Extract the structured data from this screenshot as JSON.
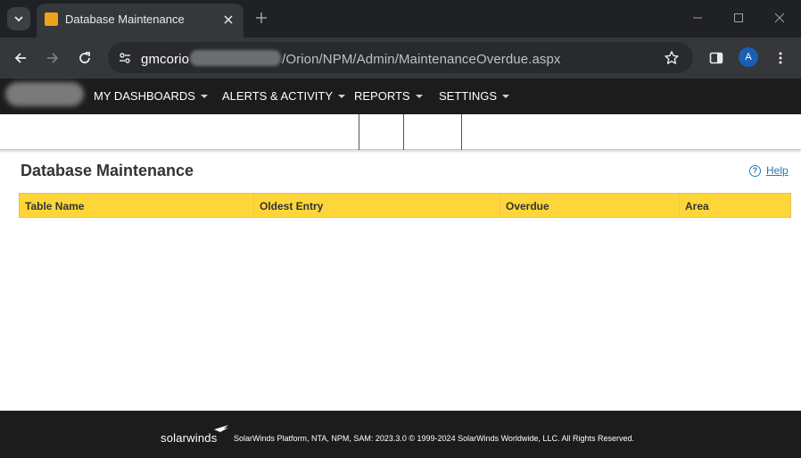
{
  "browser": {
    "tab_title": "Database Maintenance",
    "url_host": "gmcorio",
    "url_path": "/Orion/NPM/Admin/MaintenanceOverdue.aspx",
    "profile_initial": "A"
  },
  "nav": {
    "items": [
      "MY DASHBOARDS",
      "ALERTS & ACTIVITY",
      "REPORTS",
      "SETTINGS"
    ]
  },
  "page": {
    "title": "Database Maintenance",
    "help_label": "Help",
    "help_icon_glyph": "?"
  },
  "table": {
    "columns": [
      "Table Name",
      "Oldest Entry",
      "Overdue",
      "Area"
    ],
    "rows": []
  },
  "footer": {
    "brand": "solarwinds",
    "copyright": "SolarWinds Platform, NTA, NPM, SAM: 2023.3.0 © 1999-2024 SolarWinds Worldwide, LLC. All Rights Reserved."
  },
  "colors": {
    "header_yellow": "#ffd639",
    "nav_dark": "#1c1c1c",
    "link_blue": "#2a7ab0",
    "brand_orange": "#f0a21c"
  }
}
